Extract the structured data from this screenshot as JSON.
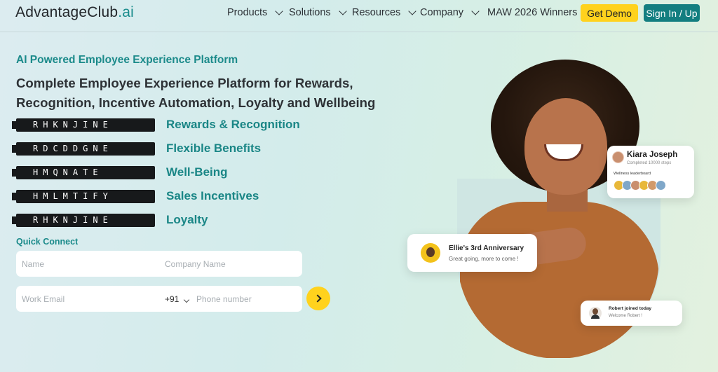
{
  "nav": {
    "logo_main": "AdvantageClub",
    "logo_suffix": ".ai",
    "items": [
      {
        "label": "Products"
      },
      {
        "label": "Solutions"
      },
      {
        "label": "Resources"
      },
      {
        "label": "Company"
      },
      {
        "label": "MAW 2026 Winners"
      }
    ],
    "get_demo": "Get Demo",
    "sign_in": "Sign In / Up"
  },
  "hero": {
    "eyebrow": "AI Powered Employee Experience Platform",
    "headline": "Complete Employee Experience Platform for Rewards, Recognition, Incentive Automation, Loyalty and Wellbeing",
    "features": [
      {
        "scramble": "RHKNJINE",
        "label": "Rewards & Recognition"
      },
      {
        "scramble": "RDCDDGNE",
        "label": "Flexible Benefits"
      },
      {
        "scramble": "HMQNATE",
        "label": "Well-Being"
      },
      {
        "scramble": "HMLMTIFY",
        "label": "Sales Incentives"
      },
      {
        "scramble": "RHKNJINE",
        "label": "Loyalty"
      }
    ]
  },
  "quick_connect": {
    "label": "Quick Connect",
    "name_placeholder": "Name",
    "company_placeholder": "Company Name",
    "email_placeholder": "Work Email",
    "country_code": "+91",
    "phone_placeholder": "Phone number"
  },
  "cards": {
    "kiara": {
      "name": "Kiara  Joseph",
      "sub": "Completed 10000 steps",
      "board": "Wellness leaderboard"
    },
    "ellie": {
      "title": "Ellie's 3rd Anniversary",
      "sub": "Great going, more to come !"
    },
    "robert": {
      "title": "Robert joined today",
      "sub": "Welcome Robert !"
    }
  },
  "colors": {
    "accent": "#1a8686",
    "brand_yellow": "#ffd21d",
    "brand_teal": "#137e80"
  }
}
